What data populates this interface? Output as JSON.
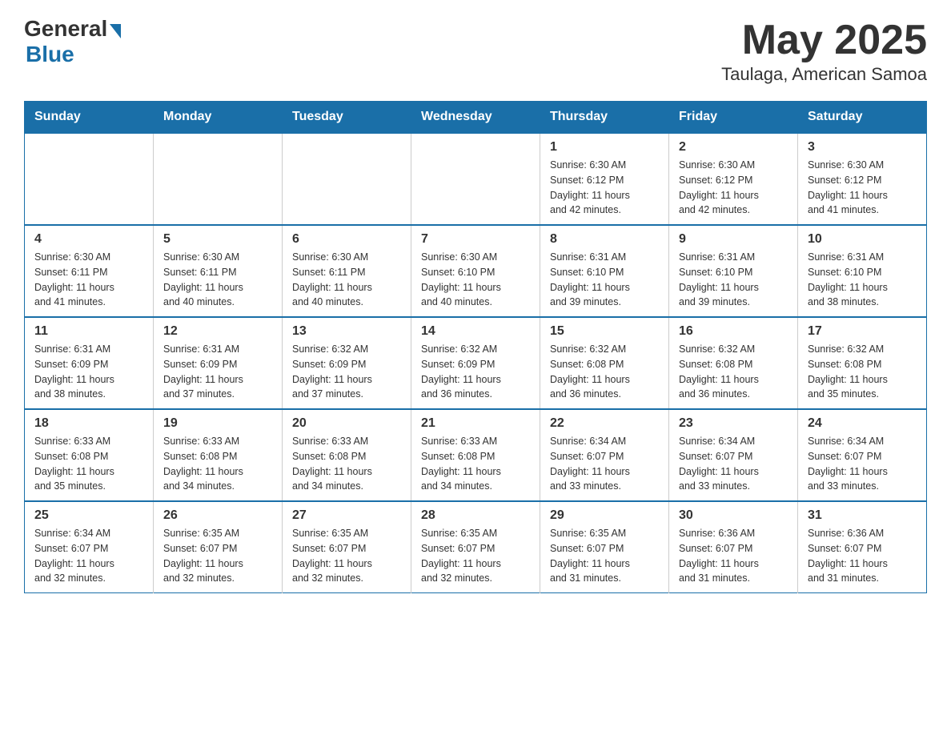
{
  "header": {
    "logo_general": "General",
    "logo_blue": "Blue",
    "month_title": "May 2025",
    "location": "Taulaga, American Samoa"
  },
  "days_of_week": [
    "Sunday",
    "Monday",
    "Tuesday",
    "Wednesday",
    "Thursday",
    "Friday",
    "Saturday"
  ],
  "weeks": [
    [
      {
        "day": "",
        "info": ""
      },
      {
        "day": "",
        "info": ""
      },
      {
        "day": "",
        "info": ""
      },
      {
        "day": "",
        "info": ""
      },
      {
        "day": "1",
        "info": "Sunrise: 6:30 AM\nSunset: 6:12 PM\nDaylight: 11 hours\nand 42 minutes."
      },
      {
        "day": "2",
        "info": "Sunrise: 6:30 AM\nSunset: 6:12 PM\nDaylight: 11 hours\nand 42 minutes."
      },
      {
        "day": "3",
        "info": "Sunrise: 6:30 AM\nSunset: 6:12 PM\nDaylight: 11 hours\nand 41 minutes."
      }
    ],
    [
      {
        "day": "4",
        "info": "Sunrise: 6:30 AM\nSunset: 6:11 PM\nDaylight: 11 hours\nand 41 minutes."
      },
      {
        "day": "5",
        "info": "Sunrise: 6:30 AM\nSunset: 6:11 PM\nDaylight: 11 hours\nand 40 minutes."
      },
      {
        "day": "6",
        "info": "Sunrise: 6:30 AM\nSunset: 6:11 PM\nDaylight: 11 hours\nand 40 minutes."
      },
      {
        "day": "7",
        "info": "Sunrise: 6:30 AM\nSunset: 6:10 PM\nDaylight: 11 hours\nand 40 minutes."
      },
      {
        "day": "8",
        "info": "Sunrise: 6:31 AM\nSunset: 6:10 PM\nDaylight: 11 hours\nand 39 minutes."
      },
      {
        "day": "9",
        "info": "Sunrise: 6:31 AM\nSunset: 6:10 PM\nDaylight: 11 hours\nand 39 minutes."
      },
      {
        "day": "10",
        "info": "Sunrise: 6:31 AM\nSunset: 6:10 PM\nDaylight: 11 hours\nand 38 minutes."
      }
    ],
    [
      {
        "day": "11",
        "info": "Sunrise: 6:31 AM\nSunset: 6:09 PM\nDaylight: 11 hours\nand 38 minutes."
      },
      {
        "day": "12",
        "info": "Sunrise: 6:31 AM\nSunset: 6:09 PM\nDaylight: 11 hours\nand 37 minutes."
      },
      {
        "day": "13",
        "info": "Sunrise: 6:32 AM\nSunset: 6:09 PM\nDaylight: 11 hours\nand 37 minutes."
      },
      {
        "day": "14",
        "info": "Sunrise: 6:32 AM\nSunset: 6:09 PM\nDaylight: 11 hours\nand 36 minutes."
      },
      {
        "day": "15",
        "info": "Sunrise: 6:32 AM\nSunset: 6:08 PM\nDaylight: 11 hours\nand 36 minutes."
      },
      {
        "day": "16",
        "info": "Sunrise: 6:32 AM\nSunset: 6:08 PM\nDaylight: 11 hours\nand 36 minutes."
      },
      {
        "day": "17",
        "info": "Sunrise: 6:32 AM\nSunset: 6:08 PM\nDaylight: 11 hours\nand 35 minutes."
      }
    ],
    [
      {
        "day": "18",
        "info": "Sunrise: 6:33 AM\nSunset: 6:08 PM\nDaylight: 11 hours\nand 35 minutes."
      },
      {
        "day": "19",
        "info": "Sunrise: 6:33 AM\nSunset: 6:08 PM\nDaylight: 11 hours\nand 34 minutes."
      },
      {
        "day": "20",
        "info": "Sunrise: 6:33 AM\nSunset: 6:08 PM\nDaylight: 11 hours\nand 34 minutes."
      },
      {
        "day": "21",
        "info": "Sunrise: 6:33 AM\nSunset: 6:08 PM\nDaylight: 11 hours\nand 34 minutes."
      },
      {
        "day": "22",
        "info": "Sunrise: 6:34 AM\nSunset: 6:07 PM\nDaylight: 11 hours\nand 33 minutes."
      },
      {
        "day": "23",
        "info": "Sunrise: 6:34 AM\nSunset: 6:07 PM\nDaylight: 11 hours\nand 33 minutes."
      },
      {
        "day": "24",
        "info": "Sunrise: 6:34 AM\nSunset: 6:07 PM\nDaylight: 11 hours\nand 33 minutes."
      }
    ],
    [
      {
        "day": "25",
        "info": "Sunrise: 6:34 AM\nSunset: 6:07 PM\nDaylight: 11 hours\nand 32 minutes."
      },
      {
        "day": "26",
        "info": "Sunrise: 6:35 AM\nSunset: 6:07 PM\nDaylight: 11 hours\nand 32 minutes."
      },
      {
        "day": "27",
        "info": "Sunrise: 6:35 AM\nSunset: 6:07 PM\nDaylight: 11 hours\nand 32 minutes."
      },
      {
        "day": "28",
        "info": "Sunrise: 6:35 AM\nSunset: 6:07 PM\nDaylight: 11 hours\nand 32 minutes."
      },
      {
        "day": "29",
        "info": "Sunrise: 6:35 AM\nSunset: 6:07 PM\nDaylight: 11 hours\nand 31 minutes."
      },
      {
        "day": "30",
        "info": "Sunrise: 6:36 AM\nSunset: 6:07 PM\nDaylight: 11 hours\nand 31 minutes."
      },
      {
        "day": "31",
        "info": "Sunrise: 6:36 AM\nSunset: 6:07 PM\nDaylight: 11 hours\nand 31 minutes."
      }
    ]
  ]
}
